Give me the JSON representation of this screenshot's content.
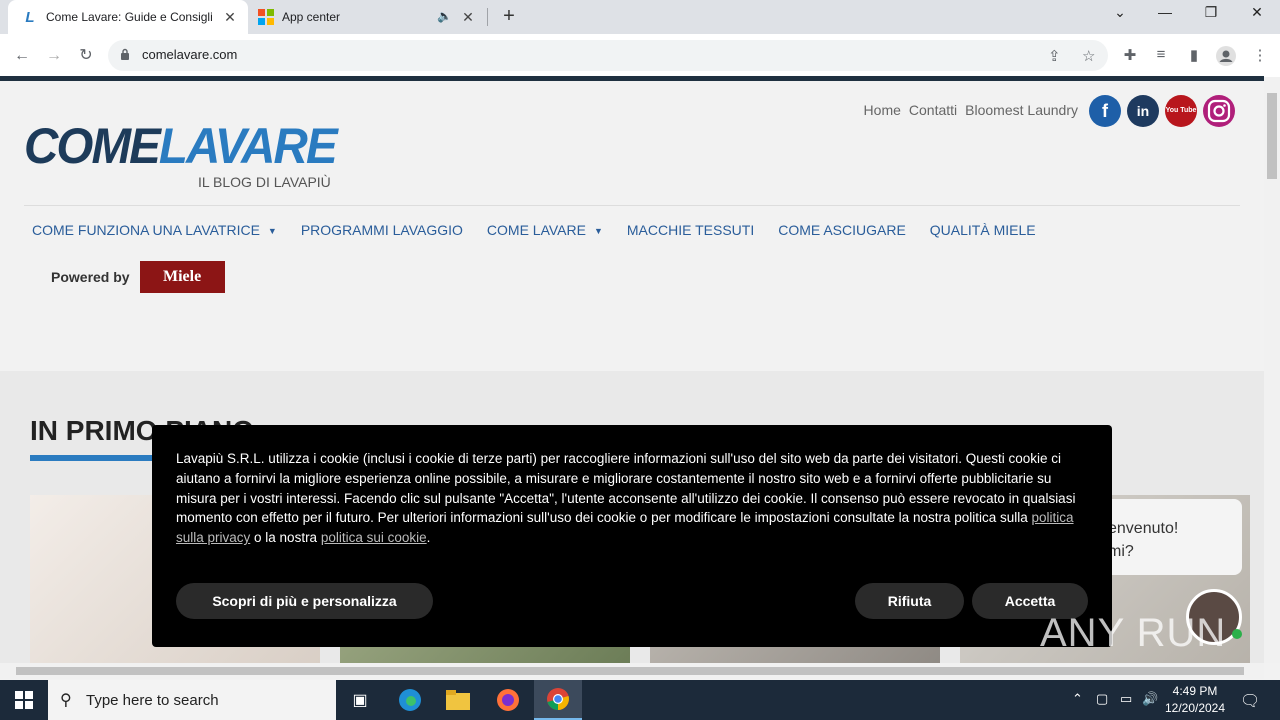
{
  "browser": {
    "tabs": [
      {
        "title": "Come Lavare: Guide e Consigli b",
        "active": true
      },
      {
        "title": "App center",
        "active": false
      }
    ],
    "url": "comelavare.com"
  },
  "site": {
    "logo_part1": "COME",
    "logo_part2": "LAVARE",
    "logo_sub": "IL BLOG DI LAVAPIÙ",
    "top_links": [
      "Home",
      "Contatti",
      "Bloomest Laundry"
    ],
    "social": [
      "f",
      "in",
      "You Tube",
      "instagram"
    ],
    "menu": [
      {
        "label": "COME FUNZIONA UNA LAVATRICE",
        "caret": true
      },
      {
        "label": "PROGRAMMI LAVAGGIO",
        "caret": false
      },
      {
        "label": "COME LAVARE",
        "caret": true
      },
      {
        "label": "MACCHIE TESSUTI",
        "caret": false
      },
      {
        "label": "COME ASCIUGARE",
        "caret": false
      },
      {
        "label": "QUALITÀ MIELE",
        "caret": false
      }
    ],
    "powered_by": "Powered by",
    "powered_brand": "Miele",
    "section_title": "IN PRIMO PIANO"
  },
  "cookie": {
    "text_1": "Lavapiù S.R.L. utilizza i cookie (inclusi i cookie di terze parti) per raccogliere informazioni sull'uso del sito web da parte dei visitatori. Questi cookie ci aiutano a fornirvi la migliore esperienza online possibile, a misurare e migliorare costantemente il nostro sito web e a fornirvi offerte pubblicitarie su misura per i vostri interessi. Facendo clic sul pulsante \"Accetta\", l'utente acconsente all'utilizzo dei cookie. Il consenso può essere revocato in qualsiasi momento con effetto per il futuro. Per ulteriori informazioni sull'uso dei cookie o per modificare le impostazioni consultate la nostra politica sulla ",
    "link_privacy": "politica sulla privacy",
    "text_2": " o la nostra ",
    "link_cookie": "politica sui cookie",
    "text_3": ".",
    "btn_customize": "Scopri di più e personalizza",
    "btn_reject": "Rifiuta",
    "btn_accept": "Accetta"
  },
  "chat": {
    "line1": "envenuto!",
    "line2": "mi?"
  },
  "watermark": "ANY RUN",
  "taskbar": {
    "search_placeholder": "Type here to search",
    "time": "4:49 PM",
    "date": "12/20/2024"
  }
}
